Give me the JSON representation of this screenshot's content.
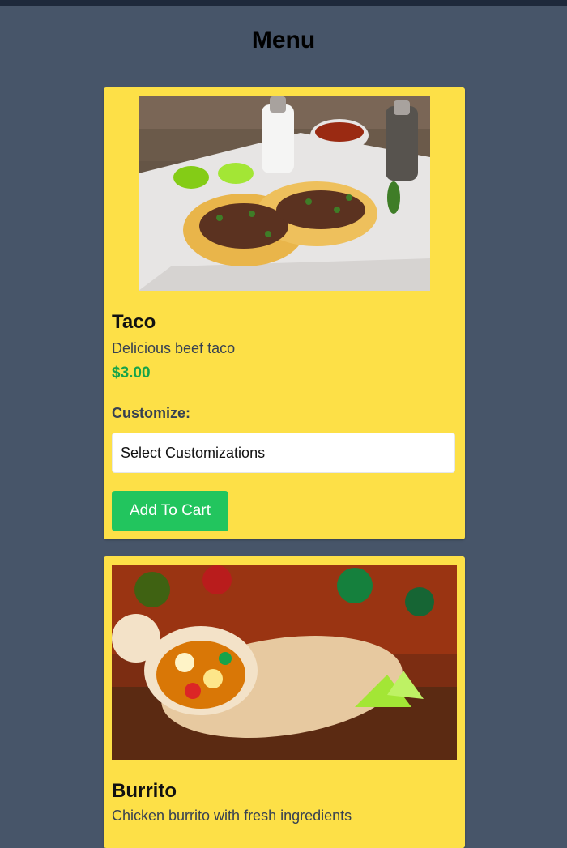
{
  "page": {
    "title": "Menu"
  },
  "items": [
    {
      "name": "Taco",
      "description": "Delicious beef taco",
      "price": "$3.00",
      "customize_label": "Customize:",
      "select_value": "Select Customizations",
      "button_label": "Add To Cart"
    },
    {
      "name": "Burrito",
      "description": "Chicken burrito with fresh ingredients"
    }
  ],
  "colors": {
    "background": "#475569",
    "card": "#fde047",
    "price": "#16a34a",
    "button": "#22c55e"
  }
}
